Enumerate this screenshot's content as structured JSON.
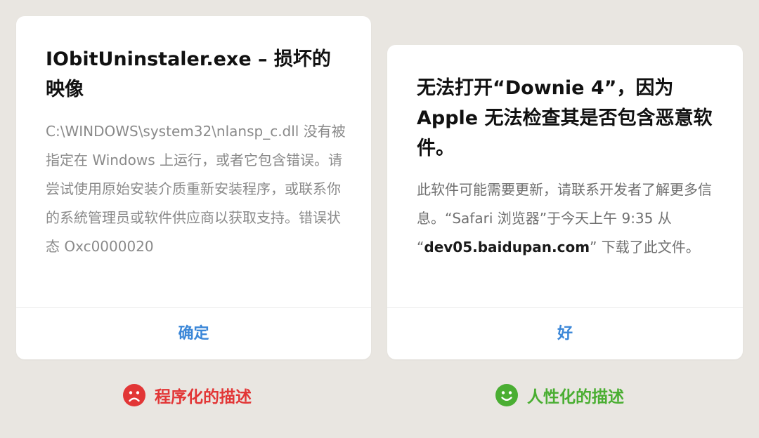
{
  "left_dialog": {
    "title": "IObitUninstaler.exe – 损坏的映像",
    "body": "C:\\WINDOWS\\system32\\nlansp_c.dll 没有被指定在 Windows 上运行，或者它包含错误。请尝试使用原始安装介质重新安装程序，或联系你的系統管理员或软件供应商以获取支持。错误状态 Oxc0000020",
    "button_label": "确定"
  },
  "right_dialog": {
    "title": "无法打开“Downie 4”，因为 Apple 无法检查其是否包含恶意软件。",
    "body_before": "此软件可能需要更新，请联系开发者了解更多信息。“Safari 浏览器”于今天上午 9:35 从 “",
    "body_domain": "dev05.baidupan.com",
    "body_after": "” 下载了此文件。",
    "button_label": "好"
  },
  "captions": {
    "left": {
      "label": "程序化的描述",
      "icon": "sad-face-icon",
      "color": "#e23636"
    },
    "right": {
      "label": "人性化的描述",
      "icon": "happy-face-icon",
      "color": "#4aae32"
    }
  },
  "colors": {
    "background": "#e9e6e1",
    "button_text": "#3b87d8"
  }
}
